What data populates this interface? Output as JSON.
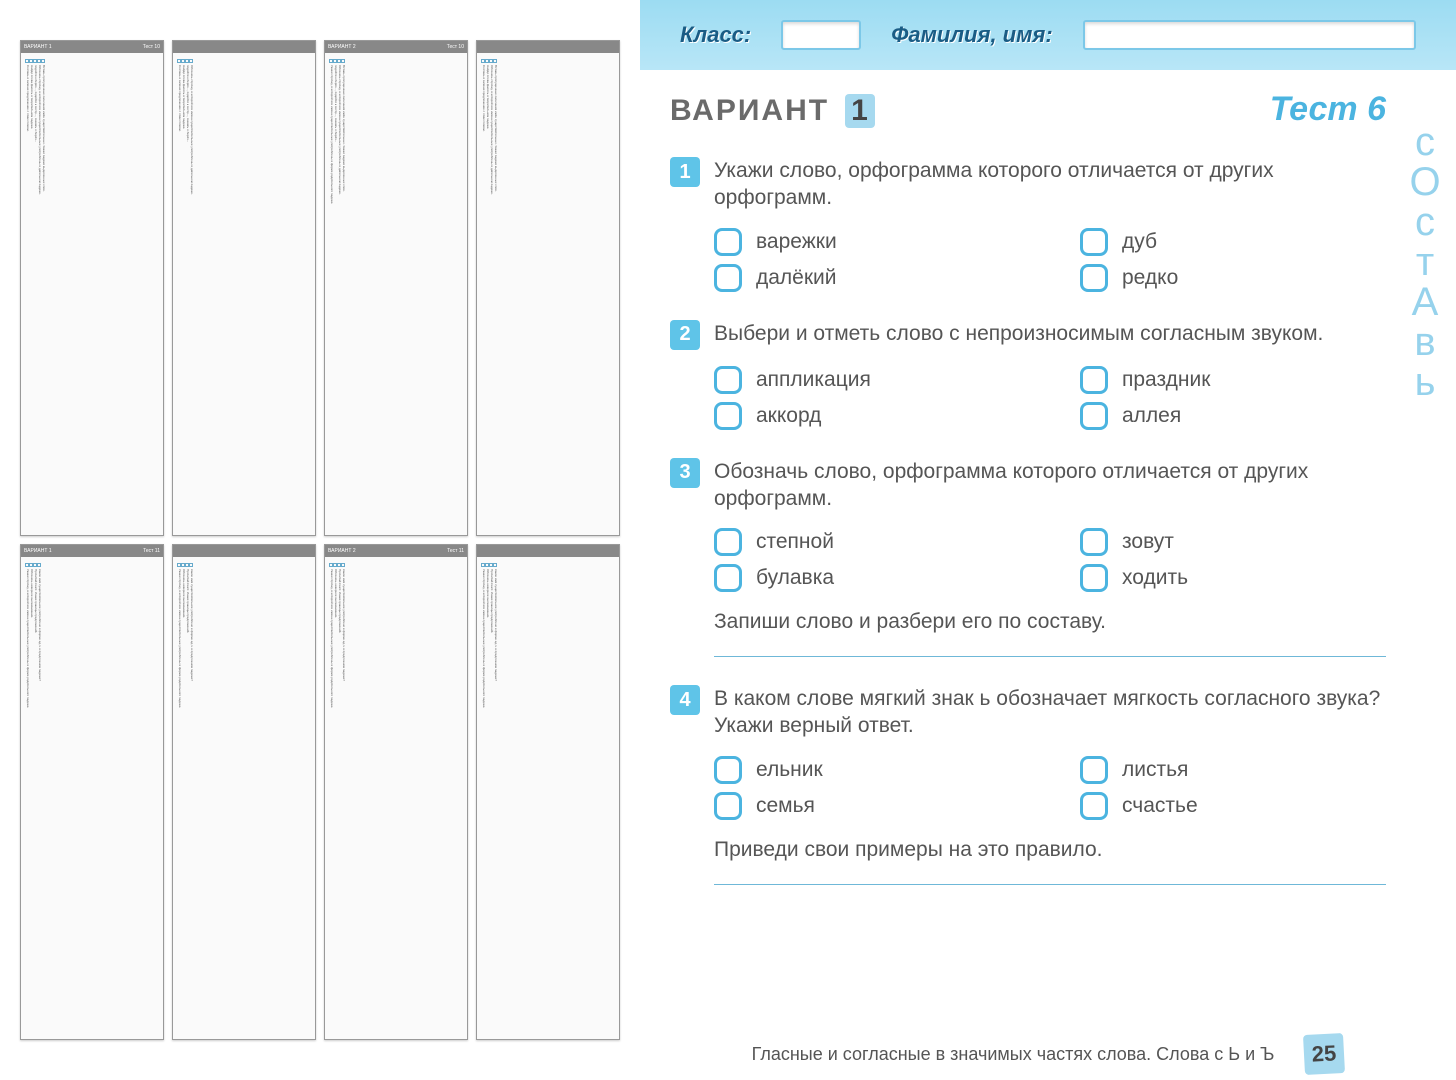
{
  "left": {
    "thumbs": [
      {
        "variant": "ВАРИАНТ 1",
        "test": "Тест 10"
      },
      {
        "variant": "",
        "test": ""
      },
      {
        "variant": "ВАРИАНТ 2",
        "test": "Тест 10"
      },
      {
        "variant": "",
        "test": ""
      },
      {
        "variant": "ВАРИАНТ 1",
        "test": "Тест 11"
      },
      {
        "variant": "",
        "test": ""
      },
      {
        "variant": "ВАРИАНТ 2",
        "test": "Тест 11"
      },
      {
        "variant": "",
        "test": ""
      }
    ],
    "filler_lines": [
      "Вставь пропущенные окончания имён существительных. Укажи падежи выделенных слов.",
      "Обозначь строчку, в которой все имена существительные употреблены в дательном падеже.",
      "подойти к берёз..., подойти к сестр..., сказать о берёз...",
      "Найди слова фасоль в творительном падеже.",
      "Составь и запиши предложение с этим словом.",
      "Какое имя существительное употреблено в форме ед.ч. в предложном падеже?",
      "Прочитай текст. Укажи границы предложений.",
      "Обозначь неверное высказывание.",
      "Укажи строчку, в которой все имена существительные употреблены в форме родительного падеже."
    ]
  },
  "header": {
    "class_label": "Класс:",
    "name_label": "Фамилия, имя:"
  },
  "variant": {
    "title": "ВАРИАНТ",
    "num": "1",
    "test": "Тест 6"
  },
  "questions": [
    {
      "num": "1",
      "text": "Укажи слово, орфограмма которого отличается от других орфограмм.",
      "options": [
        "варежки",
        "дуб",
        "далёкий",
        "редко"
      ]
    },
    {
      "num": "2",
      "text": "Выбери и отметь слово с непроизносимым согласным звуком.",
      "options": [
        "аппликация",
        "праздник",
        "аккорд",
        "аллея"
      ]
    },
    {
      "num": "3",
      "text": "Обозначь слово, орфограмма которого отличается от других орфограмм.",
      "options": [
        "степной",
        "зовут",
        "булавка",
        "ходить"
      ],
      "sub": "Запиши слово и разбери его по составу."
    },
    {
      "num": "4",
      "text": "В каком слове мягкий знак ь обозначает мягкость согласного звука? Укажи верный ответ.",
      "options": [
        "ельник",
        "листья",
        "семья",
        "счастье"
      ],
      "sub": "Приведи свои примеры на это правило."
    }
  ],
  "footer": {
    "text": "Гласные и согласные в значимых частях слова. Слова с Ь и Ъ",
    "page": "25"
  },
  "doodle": "сОстАвь"
}
